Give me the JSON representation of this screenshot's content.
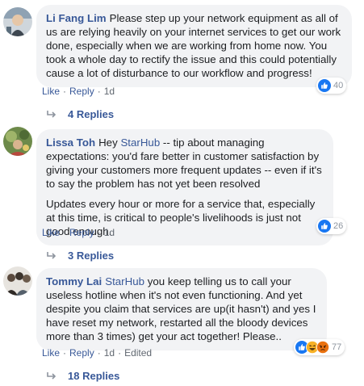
{
  "comments": [
    {
      "author": "Li Fang Lim",
      "paragraphs": [
        "Please step up your network equipment as all of us are relying heavily on your internet services to get our work done, especially when we are working from home now. You took a whole day to rectify the issue and this could potentially cause a lot of disturbance to our workflow and progress!"
      ],
      "reaction_count": "40",
      "actions": {
        "like": "Like",
        "reply": "Reply",
        "time": "1d",
        "edited": ""
      },
      "replies_label": "4 Replies"
    },
    {
      "author": "Lissa Toh",
      "mention": "StarHub",
      "pre_mention": "Hey",
      "paragraph1_rest": "-- tip about managing expectations: you'd fare better in customer satisfaction by giving your customers more frequent updates -- even if it's to say the problem has not yet been resolved",
      "paragraph2": "Updates every hour or more for a service that, especially at this time, is critical to people's livelihoods is just not good enough.",
      "reaction_count": "26",
      "actions": {
        "like": "Like",
        "reply": "Reply",
        "time": "1d",
        "edited": ""
      },
      "replies_label": "3 Replies"
    },
    {
      "author": "Tommy Lai",
      "mention": "StarHub",
      "paragraph1_rest": "you keep telling us to call your useless hotline when it's not even functioning. And yet despite you claim that services are up(it hasn't) and yes I have reset my network, restarted all the bloody devices more than 3 times) get your act together! Please..",
      "reaction_count": "77",
      "actions": {
        "like": "Like",
        "reply": "Reply",
        "time": "1d",
        "edited": "Edited"
      },
      "replies_label": "18 Replies"
    }
  ],
  "separator": "·",
  "icons": {
    "like": "like-reaction-icon",
    "haha": "haha-reaction-icon",
    "angry": "angry-reaction-icon",
    "reply_arrow": "reply-arrow-icon"
  },
  "colors": {
    "link": "#385898",
    "bubble": "#f2f3f5",
    "like_blue": "#1877f2",
    "haha_yellow": "#f7b125",
    "angry_orange": "#e9710f"
  }
}
